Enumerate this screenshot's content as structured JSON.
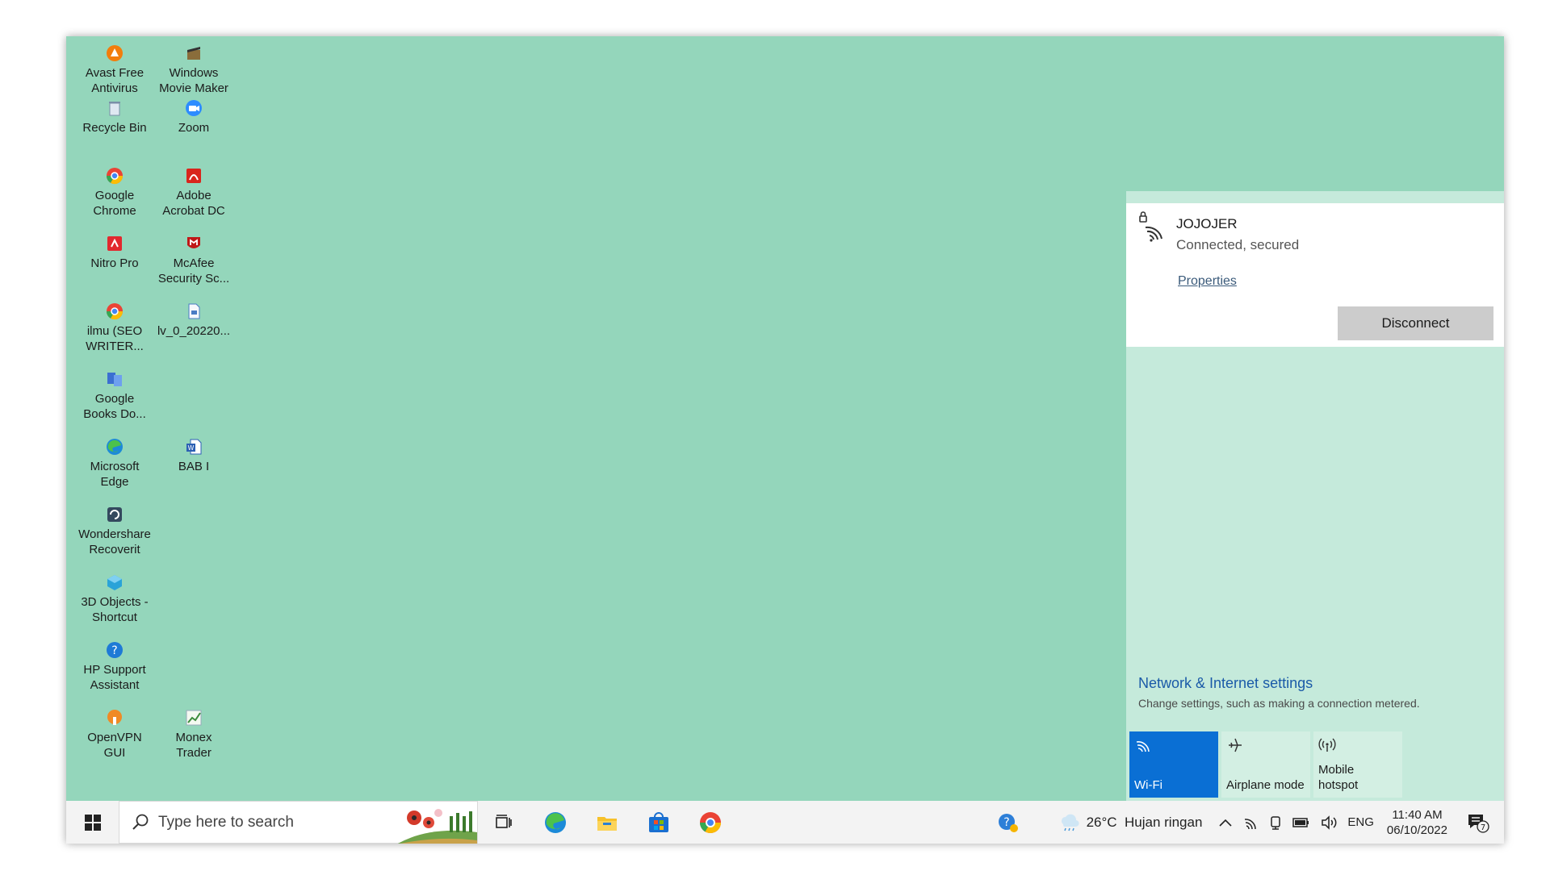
{
  "desktop": {
    "icons": [
      {
        "label": "Avast Free\nAntivirus",
        "icon": "avast-icon",
        "color": "#f27d0c"
      },
      {
        "label": "Windows\nMovie Maker",
        "icon": "movie-maker-icon",
        "color": "#8a6d3b"
      },
      {
        "label": "Recycle Bin",
        "icon": "recycle-bin-icon",
        "color": "#7a8fa8"
      },
      {
        "label": "Zoom",
        "icon": "zoom-icon",
        "color": "#2d8cff"
      },
      {
        "label": "Google\nChrome",
        "icon": "chrome-icon",
        "color": "#ea4335"
      },
      {
        "label": "Adobe\nAcrobat DC",
        "icon": "acrobat-icon",
        "color": "#d9251c"
      },
      {
        "label": "Nitro Pro",
        "icon": "nitro-icon",
        "color": "#e2282e"
      },
      {
        "label": "McAfee\nSecurity Sc...",
        "icon": "mcafee-icon",
        "color": "#c01818"
      },
      {
        "label": "ilmu (SEO\nWRITER...",
        "icon": "chrome-shortcut-icon",
        "color": "#ea4335"
      },
      {
        "label": "lv_0_20220...",
        "icon": "file-icon",
        "color": "#4a7cc4"
      },
      {
        "label": "Google\nBooks Do...",
        "icon": "books-downloader-icon",
        "color": "#3b6fd1"
      },
      {
        "label": "Microsoft\nEdge",
        "icon": "edge-icon",
        "color": "#1c8ad8"
      },
      {
        "label": "BAB I",
        "icon": "word-doc-icon",
        "color": "#2b5fb4"
      },
      {
        "label": "Wondershare\nRecoverit",
        "icon": "recoverit-icon",
        "color": "#34495e"
      },
      {
        "label": "3D Objects -\nShortcut",
        "icon": "3d-objects-icon",
        "color": "#2aa3d8"
      },
      {
        "label": "HP Support\nAssistant",
        "icon": "hp-support-icon",
        "color": "#1e7ad6"
      },
      {
        "label": "OpenVPN\nGUI",
        "icon": "openvpn-icon",
        "color": "#f08a24"
      },
      {
        "label": "Monex\nTrader",
        "icon": "monex-icon",
        "color": "#3c8c3c"
      }
    ]
  },
  "taskbar": {
    "search_placeholder": "Type here to search",
    "weather": "26°C  Hujan ringan",
    "language": "ENG",
    "time": "11:40 AM",
    "date": "06/10/2022",
    "notification_count": "7"
  },
  "network_flyout": {
    "network_name": "JOJOJER",
    "status": "Connected, secured",
    "properties_link": "Properties",
    "disconnect_label": "Disconnect",
    "settings_link": "Network & Internet settings",
    "settings_description": "Change settings, such as making a connection metered.",
    "quick_actions": [
      {
        "label": "Wi-Fi",
        "icon": "wifi-icon",
        "active": true
      },
      {
        "label": "Airplane mode",
        "icon": "airplane-icon",
        "active": false
      },
      {
        "label": "Mobile\nhotspot",
        "icon": "hotspot-icon",
        "active": false
      }
    ]
  },
  "colors": {
    "desktop_bg": "#94d6bb",
    "flyout_bg": "#c5eadb",
    "accent": "#0a6fd4",
    "link": "#1a5aa8"
  }
}
